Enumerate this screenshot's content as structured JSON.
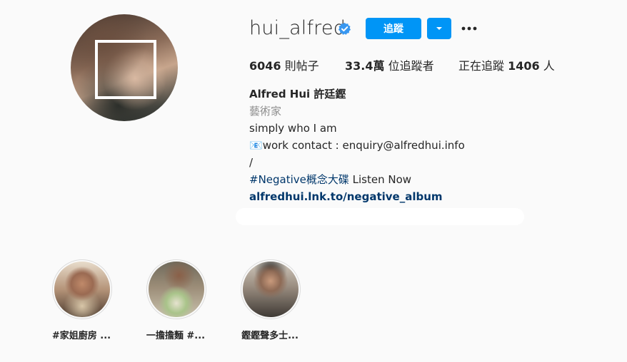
{
  "profile": {
    "username": "hui_alfred",
    "verified": true,
    "follow_label": "追蹤",
    "icons": {
      "verified": "verified-badge-icon",
      "dropdown": "chevron-down-icon",
      "more": "more-options-icon"
    },
    "colors": {
      "accent": "#0095f6",
      "link": "#00376b",
      "muted": "#8e8e8e"
    }
  },
  "stats": {
    "posts_count": "6046",
    "posts_label": "則帖子",
    "followers_count": "33.4萬",
    "followers_label": "位追蹤者",
    "following_prefix": "正在追蹤",
    "following_count": "1406",
    "following_suffix": "人"
  },
  "bio": {
    "full_name": "Alfred Hui 許廷鏗",
    "category": "藝術家",
    "line1": "simply who I am",
    "line2_icon": "📧",
    "line2": "work contact : enquiry@alfredhui.info",
    "line3": "/",
    "hashtag": "#Negative概念大碟",
    "hashtag_rest": " Listen Now",
    "link": "alfredhui.lnk.to/negative_album"
  },
  "highlights": [
    {
      "label": "#家姐廚房 ..."
    },
    {
      "label": "一擔擔麵 #..."
    },
    {
      "label": "鏗鏗聲多士..."
    }
  ]
}
